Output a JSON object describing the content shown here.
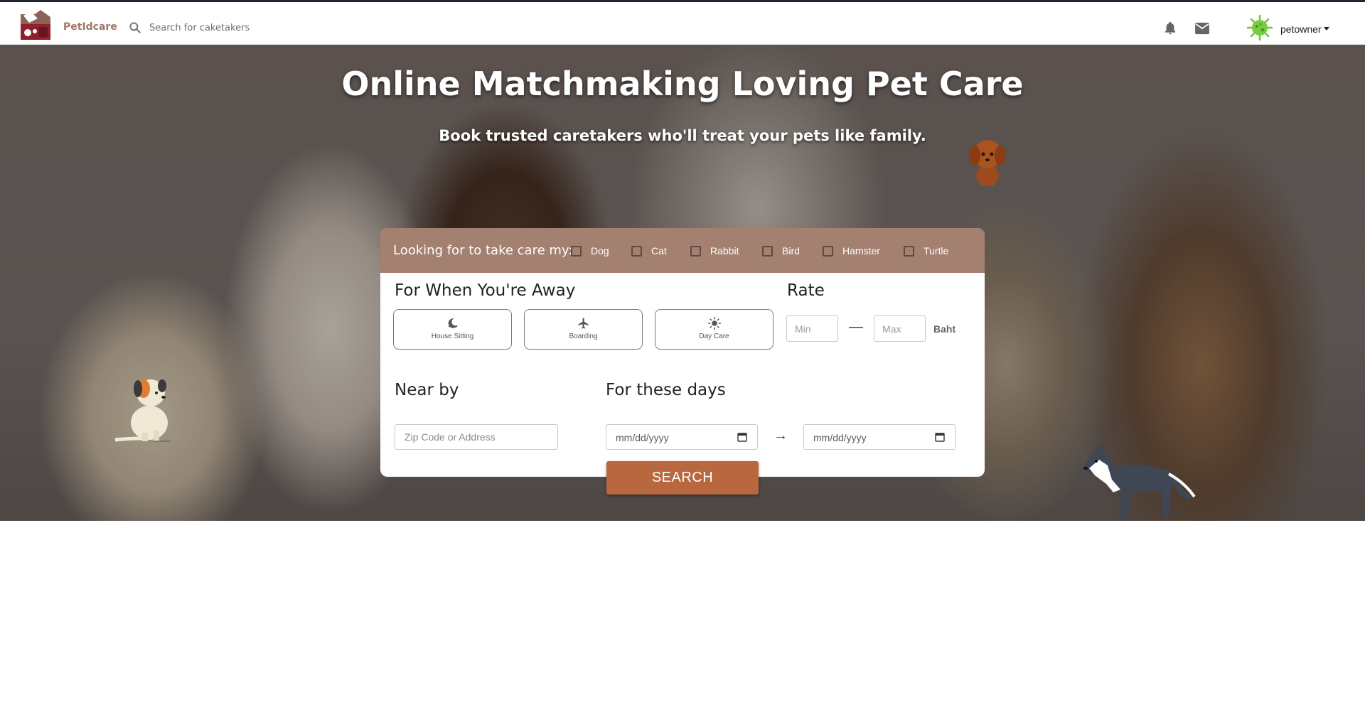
{
  "header": {
    "brand": "PetIdcare",
    "search_placeholder": "Search for caketakers",
    "username": "petowner",
    "icons": [
      "app-logo-icon",
      "search-icon",
      "notifications-bell-icon",
      "mail-icon",
      "user-avatar",
      "dropdown-caret-icon"
    ]
  },
  "hero": {
    "title": "Online Matchmaking Loving Pet Care",
    "subtitle": "Book trusted caretakers who'll treat your pets like family."
  },
  "search_form": {
    "pet_label": "Looking for to take care my:",
    "pet_types": [
      {
        "label": "Dog",
        "checked": false
      },
      {
        "label": "Cat",
        "checked": false
      },
      {
        "label": "Rabbit",
        "checked": false
      },
      {
        "label": "Bird",
        "checked": false
      },
      {
        "label": "Hamster",
        "checked": false
      },
      {
        "label": "Turtle",
        "checked": false
      }
    ],
    "away_title": "For When You're Away",
    "services": [
      {
        "label": "House Sitting",
        "icon": "moon-icon"
      },
      {
        "label": "Boarding",
        "icon": "airplane-icon"
      },
      {
        "label": "Day Care",
        "icon": "sun-icon"
      }
    ],
    "rate_title": "Rate",
    "rate_min_placeholder": "Min",
    "rate_separator": "—",
    "rate_max_placeholder": "Max",
    "rate_unit": "Baht",
    "nearby_title": "Near by",
    "nearby_placeholder": "Zip Code or Address",
    "days_title": "For these days",
    "date_from_placeholder": "mm/dd/yyyy",
    "date_arrow": "→",
    "date_to_placeholder": "mm/dd/yyyy",
    "search_button": "SEARCH"
  },
  "colors": {
    "brand_text": "#a0776a",
    "card_header": "#a3806f",
    "search_button": "#b9673f",
    "topbar_border": "#1f2433"
  }
}
